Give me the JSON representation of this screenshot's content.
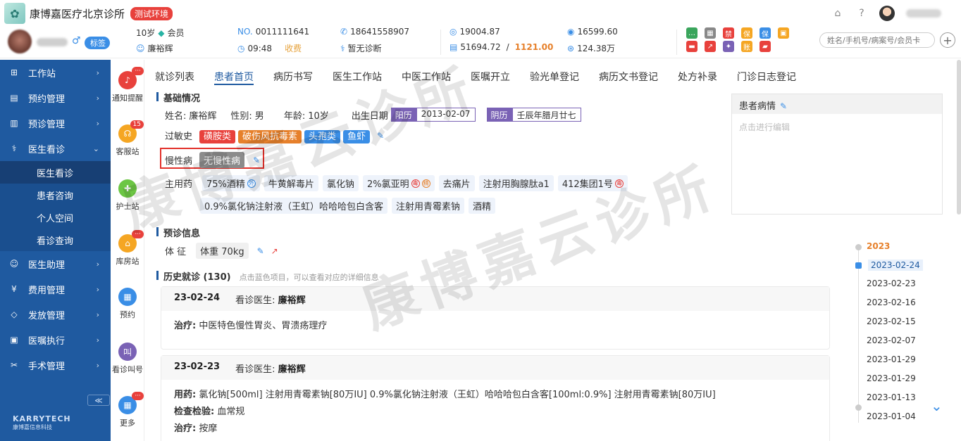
{
  "app": {
    "clinic_name": "康博嘉医疗北京诊所",
    "env_badge": "测试环境"
  },
  "patient": {
    "tag_label": "标签",
    "age": "10岁",
    "member": "会员",
    "doctor": "廉裕辉",
    "no_prefix": "NO.",
    "number": "0011111641",
    "time": "09:48",
    "charge_status": "收费",
    "phone": "18641558907",
    "diagnosis_status": "暂无诊断",
    "balance1": "19004.87",
    "balance2": "51694.72",
    "balance_sep": "/",
    "balance_highlight": "1121.00",
    "amount1": "16599.60",
    "amount2": "124.38万"
  },
  "quick_icons": [
    {
      "icon": "chat-icon",
      "color": "#3aa55c",
      "glyph": "…"
    },
    {
      "icon": "grid-icon",
      "color": "#888888",
      "glyph": "▦"
    },
    {
      "icon": "ban-icon",
      "color": "#e8413c",
      "glyph": "禁"
    },
    {
      "icon": "insure-icon",
      "color": "#f5a623",
      "glyph": "保"
    },
    {
      "icon": "shield-icon",
      "color": "#3a8ee6",
      "glyph": "保"
    },
    {
      "icon": "gift-icon",
      "color": "#f5a623",
      "glyph": "▣"
    },
    {
      "icon": "card-icon",
      "color": "#e8413c",
      "glyph": "▬"
    },
    {
      "icon": "chart-icon",
      "color": "#e8413c",
      "glyph": "↗"
    },
    {
      "icon": "bulb-icon",
      "color": "#7a62b5",
      "glyph": "✦"
    },
    {
      "icon": "bill-icon",
      "color": "#f5a623",
      "glyph": "账"
    },
    {
      "icon": "wallet-icon",
      "color": "#e8413c",
      "glyph": "▰"
    }
  ],
  "search": {
    "placeholder": "姓名/手机号/病案号/会员卡"
  },
  "sidebar": {
    "items": [
      {
        "label": "工作站",
        "icon": "workstation-icon",
        "glyph": "⊞"
      },
      {
        "label": "预约管理",
        "icon": "calendar-icon",
        "glyph": "▤"
      },
      {
        "label": "预诊管理",
        "icon": "clipboard-icon",
        "glyph": "▥"
      },
      {
        "label": "医生看诊",
        "icon": "stethoscope-icon",
        "glyph": "⚕"
      }
    ],
    "sub_items": [
      "医生看诊",
      "患者咨询",
      "个人空间",
      "看诊查询"
    ],
    "items2": [
      {
        "label": "医生助理",
        "icon": "assistant-icon",
        "glyph": "☺"
      },
      {
        "label": "费用管理",
        "icon": "yen-icon",
        "glyph": "¥"
      },
      {
        "label": "发放管理",
        "icon": "pill-icon",
        "glyph": "◇"
      },
      {
        "label": "医嘱执行",
        "icon": "order-icon",
        "glyph": "▣"
      },
      {
        "label": "手术管理",
        "icon": "scissors-icon",
        "glyph": "✂"
      }
    ],
    "collapse": "≪",
    "brand": "KARRYTECH",
    "brand_sub": "康博嘉信息科技"
  },
  "tools": [
    {
      "label": "通知提醒",
      "color": "#e8413c",
      "glyph": "♪",
      "badge": "···"
    },
    {
      "label": "客服站",
      "color": "#f5a623",
      "glyph": "☊",
      "badge": "15"
    },
    {
      "label": "护士站",
      "color": "#6cc644",
      "glyph": "✚",
      "badge": ""
    },
    {
      "label": "库房站",
      "color": "#f5a623",
      "glyph": "⌂",
      "badge": "···"
    },
    {
      "label": "预约",
      "color": "#3a8ee6",
      "glyph": "▦",
      "badge": ""
    },
    {
      "label": "看诊叫号",
      "color": "#7a62b5",
      "glyph": "叫",
      "badge": ""
    },
    {
      "label": "更多",
      "color": "#3a8ee6",
      "glyph": "▦",
      "badge": "···"
    }
  ],
  "tabs": [
    "就诊列表",
    "患者首页",
    "病历书写",
    "医生工作站",
    "中医工作站",
    "医嘱开立",
    "验光单登记",
    "病历文书登记",
    "处方补录",
    "门诊日志登记"
  ],
  "basic": {
    "title": "基础情况",
    "name_label": "姓名:",
    "name": "廉裕辉",
    "gender_label": "性别:",
    "gender": "男",
    "age_label": "年龄:",
    "age": "10岁",
    "dob_label": "出生日期",
    "solar_label": "阳历",
    "solar_date": "2013-02-07",
    "lunar_label": "阴历",
    "lunar_date": "壬辰年腊月廿七",
    "allergy_label": "过敏史",
    "allergies": [
      {
        "text": "磺胺类",
        "color": "#e8413c"
      },
      {
        "text": "破伤风抗毒素",
        "color": "#e6802b"
      },
      {
        "text": "头孢类",
        "color": "#3a8ee6"
      },
      {
        "text": "鱼虾",
        "color": "#3a8ee6"
      }
    ],
    "chronic_label": "慢性病",
    "chronic_value": "无慢性病",
    "meds_label": "主用药",
    "meds_row1": [
      {
        "text": "75%酒精",
        "marks": [
          {
            "g": "外",
            "c": "#3a8ee6"
          }
        ]
      },
      {
        "text": "牛黄解毒片",
        "marks": []
      },
      {
        "text": "氯化钠",
        "marks": []
      },
      {
        "text": "2%氯亚明",
        "marks": [
          {
            "g": "毒",
            "c": "#e8413c"
          },
          {
            "g": "精",
            "c": "#e6802b"
          }
        ]
      },
      {
        "text": "去痛片",
        "marks": []
      },
      {
        "text": "注射用胸腺肽a1",
        "marks": []
      },
      {
        "text": "412集团1号",
        "marks": [
          {
            "g": "毒",
            "c": "#e8413c"
          }
        ]
      }
    ],
    "meds_row2": [
      {
        "text": "0.9%氯化钠注射液（王虹）哈哈哈包白含客",
        "marks": []
      },
      {
        "text": "注射用青霉素钠",
        "marks": []
      },
      {
        "text": "酒精",
        "marks": []
      }
    ]
  },
  "condition": {
    "title": "患者病情",
    "placeholder": "点击进行编辑"
  },
  "pre_diag": {
    "title": "预诊信息",
    "vitals_label": "体 征",
    "weight": "体重 70kg"
  },
  "history": {
    "title": "历史就诊",
    "count": "(130)",
    "hint": "点击蓝色项目，可以查看对应的详细信息",
    "doctor_label": "看诊医生:",
    "visits": [
      {
        "date": "23-02-24",
        "doctor": "廉裕辉",
        "lines": [
          {
            "k": "治疗:",
            "v": "中医特色慢性胃炎、胃溃疡理疗"
          }
        ]
      },
      {
        "date": "23-02-23",
        "doctor": "廉裕辉",
        "lines": [
          {
            "k": "用药:",
            "v": "氯化钠[500ml]    注射用青霉素钠[80万IU]    0.9%氯化钠注射液（王虹）哈哈哈包白含客[100ml:0.9%]    注射用青霉素钠[80万IU]"
          },
          {
            "k": "检查检验:",
            "v": "血常规"
          },
          {
            "k": "治疗:",
            "v": "按摩"
          }
        ]
      }
    ]
  },
  "timeline": {
    "year": "2023",
    "dates": [
      "2023-02-24",
      "2023-02-23",
      "2023-02-16",
      "2023-02-15",
      "2023-02-07",
      "2023-01-29",
      "2023-01-29",
      "2023-01-13",
      "2023-01-04"
    ]
  },
  "watermark": "康博嘉云诊所"
}
